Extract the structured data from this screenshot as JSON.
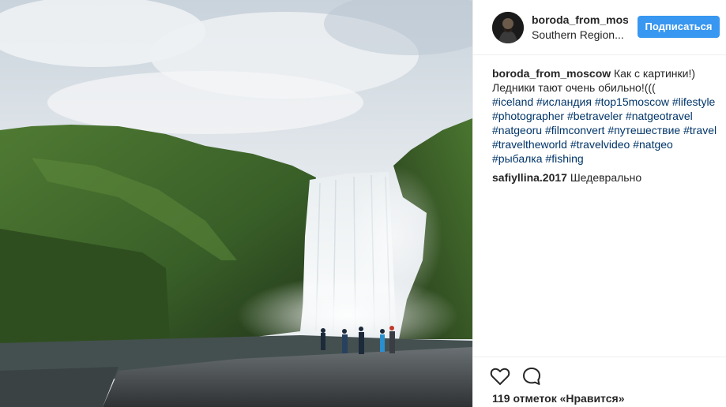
{
  "photo": {
    "alt": "waterfall-photo",
    "colors": {
      "sky": "#dfe5ea",
      "cliff": "#3e6a2a",
      "water": "#f4f7f8",
      "ground": "#3b3d3f"
    }
  },
  "header": {
    "username": "boroda_from_mos",
    "location": "Southern Region...",
    "follow_label": "Подписаться"
  },
  "caption": {
    "author": "boroda_from_moscow",
    "text_line1": "Как с картинки!)",
    "text_line2": "Ледники тают очень обильно!(((",
    "hashtags": [
      "#iceland",
      "#исландия",
      "#top15moscow",
      "#lifestyle",
      "#photographer",
      "#betraveler",
      "#natgeotravel",
      "#natgeoru",
      "#filmconvert",
      "#путешествие",
      "#travel",
      "#traveltheworld",
      "#travelvideo",
      "#natgeo",
      "#рыбалка",
      "#fishing"
    ]
  },
  "comment": {
    "author": "safiyllina.2017",
    "text": "Шедеврально"
  },
  "actions": {
    "like_icon": "heart-icon",
    "comment_icon": "speech-bubble-icon",
    "likes_text": "119 отметок «Нравится»"
  }
}
